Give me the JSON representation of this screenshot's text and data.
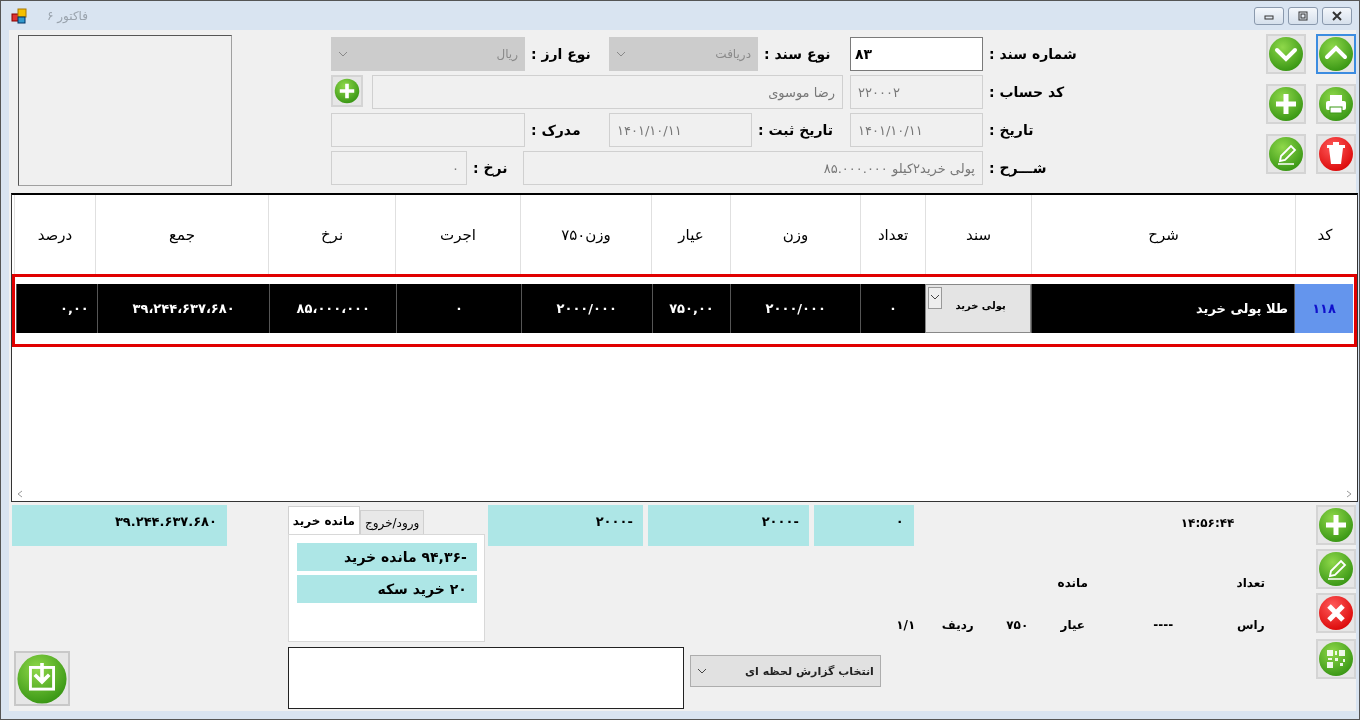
{
  "window": {
    "title": "فاکتور ۶"
  },
  "form": {
    "doc_number": {
      "label": "شماره سند :",
      "value": "۸۳"
    },
    "doc_type": {
      "label": "نوع سند :",
      "value": "دریافت",
      "disabled": true
    },
    "currency": {
      "label": "نوع ارز :",
      "value": "ریال",
      "disabled": true
    },
    "account": {
      "label": "کد حساب :",
      "code": "۲۲۰۰۰۲",
      "name": "رضا موسوی"
    },
    "date": {
      "label": "تاریخ :",
      "value": "۱۴۰۱/۱۰/۱۱"
    },
    "reg_date": {
      "label": "تاریخ ثبت :",
      "value": "۱۴۰۱/۱۰/۱۱"
    },
    "document": {
      "label": "مدرک :"
    },
    "description": {
      "label": "شـــرح :",
      "value": "پولی خرید۲کیلو ۸۵.۰۰۰.۰۰۰"
    },
    "rate": {
      "label": "نرخ :",
      "value": "۰"
    }
  },
  "table": {
    "columns": [
      {
        "label": "کد",
        "kind": "code"
      },
      {
        "label": "شرح",
        "kind": "text"
      },
      {
        "label": "سند",
        "kind": "dropdown"
      },
      {
        "label": "تعداد",
        "kind": "text"
      },
      {
        "label": "وزن",
        "kind": "text"
      },
      {
        "label": "عیار",
        "kind": "text"
      },
      {
        "label": "وزن۷۵۰",
        "kind": "text"
      },
      {
        "label": "اجرت",
        "kind": "text"
      },
      {
        "label": "نرخ",
        "kind": "text"
      },
      {
        "label": "جمع",
        "kind": "text"
      },
      {
        "label": "درصد",
        "kind": "text"
      }
    ],
    "rows": [
      {
        "selected": true,
        "cells": [
          "۱۱۸",
          "طلا پولی خرید",
          "پولی خرید",
          "۰",
          "۲۰۰۰/۰۰۰",
          "۷۵۰,۰۰",
          "۲۰۰۰/۰۰۰",
          "۰",
          "۸۵،۰۰۰،۰۰۰",
          "۳۹،۲۴۴،۶۳۷،۶۸۰",
          "۰,۰۰"
        ]
      }
    ]
  },
  "total": "۳۹.۲۴۴.۶۳۷.۶۸۰",
  "tabs": [
    {
      "label": "ورود/خروج",
      "selected": false
    },
    {
      "label": "مانده خرید",
      "selected": true
    }
  ],
  "tab_items": [
    "-۹۴,۳۶ مانده خرید",
    "۲۰ خرید سکه"
  ],
  "summary_boxes": [
    "۰",
    "۲۰۰۰-",
    "۲۰۰۰-"
  ],
  "time": "۱۴:۵۶:۴۴",
  "info": {
    "count_label": "تعداد",
    "balance_label": "مانده",
    "ras_label": "راس",
    "ras_value": "----",
    "karat_label": "عیار",
    "karat_value": "۷۵۰",
    "row_label": "ردیف",
    "row_value": "۱/۱"
  },
  "report_select": {
    "value": "انتخاب گزارش لحظه ای"
  }
}
